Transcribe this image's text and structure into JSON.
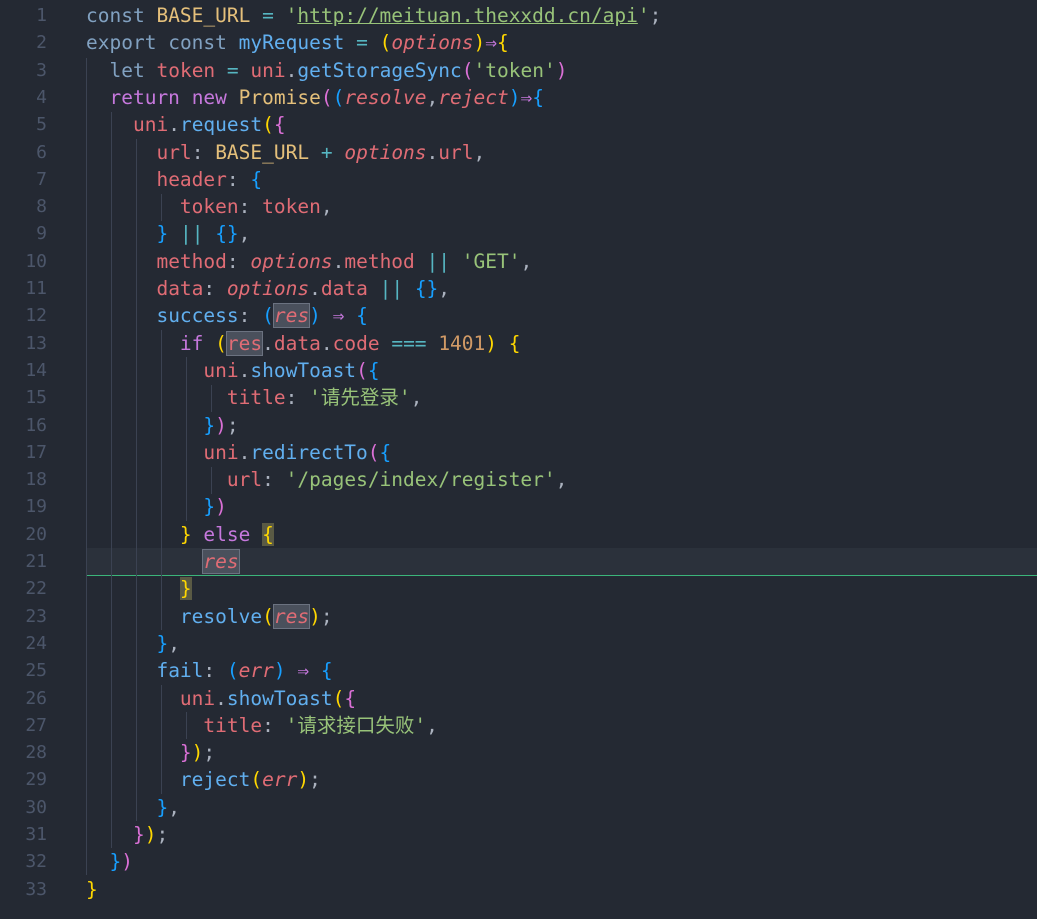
{
  "editor": {
    "line_numbers": [
      "1",
      "2",
      "3",
      "4",
      "5",
      "6",
      "7",
      "8",
      "9",
      "10",
      "11",
      "12",
      "13",
      "14",
      "15",
      "16",
      "17",
      "18",
      "19",
      "20",
      "21",
      "22",
      "23",
      "24",
      "25",
      "26",
      "27",
      "28",
      "29",
      "30",
      "31",
      "32",
      "33"
    ],
    "code": {
      "base_url_string": "http://meituan.thexxdd.cn/api",
      "storage_key": "token",
      "toast_title_login": "请先登录",
      "redirect_url": "/pages/index/register",
      "code_value": "1401",
      "method_default": "GET",
      "toast_title_fail": "请求接口失败"
    }
  }
}
